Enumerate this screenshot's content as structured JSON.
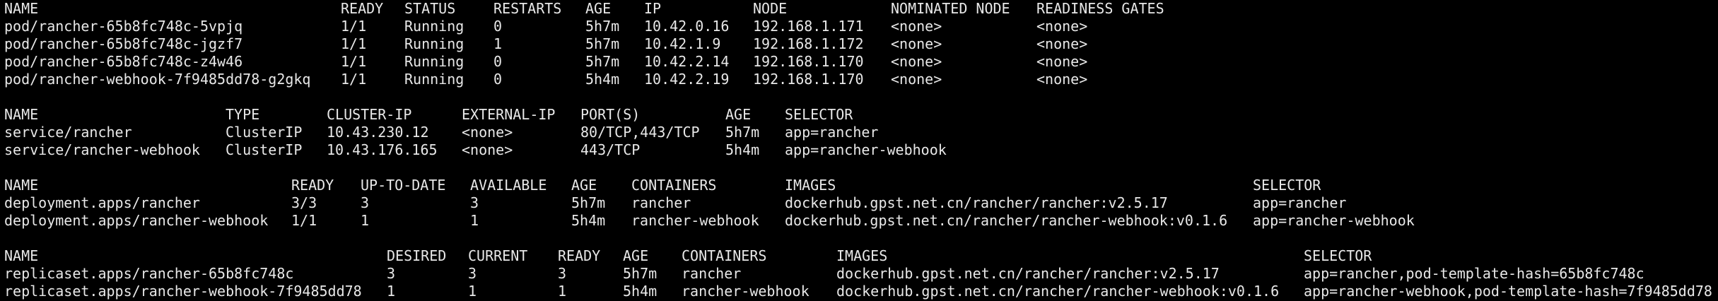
{
  "terminal": {
    "background": "#000000",
    "foreground": "#e8e8e8"
  },
  "pods": {
    "headers": [
      "NAME",
      "READY",
      "STATUS",
      "RESTARTS",
      "AGE",
      "IP",
      "NODE",
      "NOMINATED NODE",
      "READINESS GATES"
    ],
    "rows": [
      [
        "pod/rancher-65b8fc748c-5vpjq",
        "1/1",
        "Running",
        "0",
        "5h7m",
        "10.42.0.16",
        "192.168.1.171",
        "<none>",
        "<none>"
      ],
      [
        "pod/rancher-65b8fc748c-jgzf7",
        "1/1",
        "Running",
        "1",
        "5h7m",
        "10.42.1.9",
        "192.168.1.172",
        "<none>",
        "<none>"
      ],
      [
        "pod/rancher-65b8fc748c-z4w46",
        "1/1",
        "Running",
        "0",
        "5h7m",
        "10.42.2.14",
        "192.168.1.170",
        "<none>",
        "<none>"
      ],
      [
        "pod/rancher-webhook-7f9485dd78-g2gkq",
        "1/1",
        "Running",
        "0",
        "5h4m",
        "10.42.2.19",
        "192.168.1.170",
        "<none>",
        "<none>"
      ]
    ]
  },
  "services": {
    "headers": [
      "NAME",
      "TYPE",
      "CLUSTER-IP",
      "EXTERNAL-IP",
      "PORT(S)",
      "AGE",
      "SELECTOR"
    ],
    "rows": [
      [
        "service/rancher",
        "ClusterIP",
        "10.43.230.12",
        "<none>",
        "80/TCP,443/TCP",
        "5h7m",
        "app=rancher"
      ],
      [
        "service/rancher-webhook",
        "ClusterIP",
        "10.43.176.165",
        "<none>",
        "443/TCP",
        "5h4m",
        "app=rancher-webhook"
      ]
    ]
  },
  "deployments": {
    "headers": [
      "NAME",
      "READY",
      "UP-TO-DATE",
      "AVAILABLE",
      "AGE",
      "CONTAINERS",
      "IMAGES",
      "SELECTOR"
    ],
    "rows": [
      [
        "deployment.apps/rancher",
        "3/3",
        "3",
        "3",
        "5h7m",
        "rancher",
        "dockerhub.gpst.net.cn/rancher/rancher:v2.5.17",
        "app=rancher"
      ],
      [
        "deployment.apps/rancher-webhook",
        "1/1",
        "1",
        "1",
        "5h4m",
        "rancher-webhook",
        "dockerhub.gpst.net.cn/rancher/rancher-webhook:v0.1.6",
        "app=rancher-webhook"
      ]
    ]
  },
  "replicasets": {
    "headers": [
      "NAME",
      "DESIRED",
      "CURRENT",
      "READY",
      "AGE",
      "CONTAINERS",
      "IMAGES",
      "SELECTOR"
    ],
    "rows": [
      [
        "replicaset.apps/rancher-65b8fc748c",
        "3",
        "3",
        "3",
        "5h7m",
        "rancher",
        "dockerhub.gpst.net.cn/rancher/rancher:v2.5.17",
        "app=rancher,pod-template-hash=65b8fc748c"
      ],
      [
        "replicaset.apps/rancher-webhook-7f9485dd78",
        "1",
        "1",
        "1",
        "5h4m",
        "rancher-webhook",
        "dockerhub.gpst.net.cn/rancher/rancher-webhook:v0.1.6",
        "app=rancher-webhook,pod-template-hash=7f9485dd78"
      ]
    ]
  }
}
